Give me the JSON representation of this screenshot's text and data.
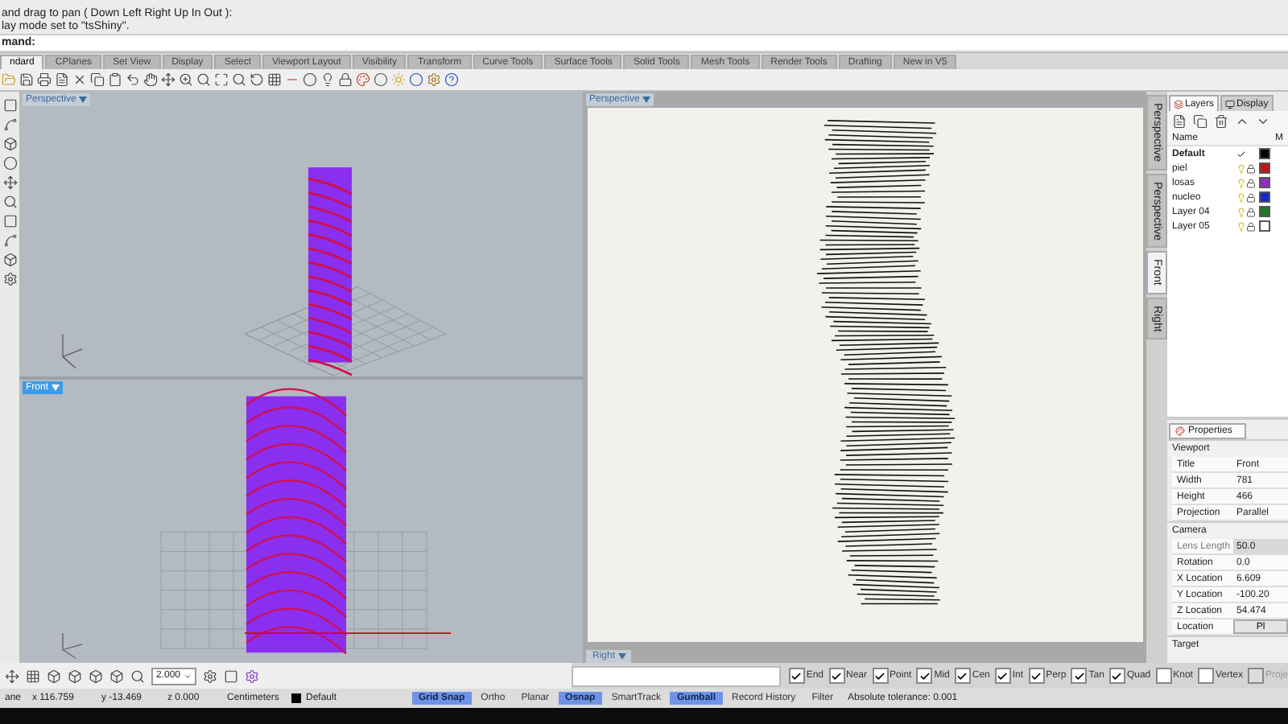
{
  "command_lines": [
    "and drag to pan ( Down  Left  Right  Up  In  Out ):",
    "lay mode set to \"tsShiny\"."
  ],
  "command_prompt": "mand:",
  "toolbar_tabs": [
    {
      "label": "ndard",
      "selected": true
    },
    {
      "label": "CPlanes",
      "selected": false
    },
    {
      "label": "Set View",
      "selected": false
    },
    {
      "label": "Display",
      "selected": false
    },
    {
      "label": "Select",
      "selected": false
    },
    {
      "label": "Viewport Layout",
      "selected": false
    },
    {
      "label": "Visibility",
      "selected": false
    },
    {
      "label": "Transform",
      "selected": false
    },
    {
      "label": "Curve Tools",
      "selected": false
    },
    {
      "label": "Surface Tools",
      "selected": false
    },
    {
      "label": "Solid Tools",
      "selected": false
    },
    {
      "label": "Mesh Tools",
      "selected": false
    },
    {
      "label": "Render Tools",
      "selected": false
    },
    {
      "label": "Drafting",
      "selected": false
    },
    {
      "label": "New in V5",
      "selected": false
    }
  ],
  "viewports": [
    {
      "title": "Perspective",
      "selected": false,
      "kind": "perspective"
    },
    {
      "title": "Front",
      "selected": true,
      "kind": "front"
    },
    {
      "title": "Perspective",
      "selected": false,
      "kind": "paper"
    }
  ],
  "hidden_viewport_title": "Right",
  "viewport_tabs": [
    {
      "label": "Perspective",
      "selected": false
    },
    {
      "label": "Perspective",
      "selected": false
    },
    {
      "label": "Front",
      "selected": true
    },
    {
      "label": "Right",
      "selected": false
    }
  ],
  "layers": {
    "tabs": [
      {
        "label": "Layers",
        "selected": true
      },
      {
        "label": "Display",
        "selected": false
      }
    ],
    "columns": [
      "Name",
      "M"
    ],
    "rows": [
      {
        "name": "Default",
        "current": true,
        "color": "#000000"
      },
      {
        "name": "piel",
        "current": false,
        "color": "#c0161c"
      },
      {
        "name": "losas",
        "current": false,
        "color": "#8e2fc0"
      },
      {
        "name": "nucleo",
        "current": false,
        "color": "#1428d0"
      },
      {
        "name": "Layer 04",
        "current": false,
        "color": "#1e7a24"
      },
      {
        "name": "Layer 05",
        "current": false,
        "color": "#ffffff"
      }
    ]
  },
  "properties": {
    "title": "Properties",
    "sections": [
      {
        "title": "Viewport",
        "rows": [
          {
            "label": "Title",
            "value": "Front",
            "disabled": false,
            "kind": "text"
          },
          {
            "label": "Width",
            "value": "781",
            "disabled": false,
            "kind": "text"
          },
          {
            "label": "Height",
            "value": "466",
            "disabled": false,
            "kind": "text"
          },
          {
            "label": "Projection",
            "value": "Parallel",
            "disabled": false,
            "kind": "text"
          }
        ]
      },
      {
        "title": "Camera",
        "rows": [
          {
            "label": "Lens Length",
            "value": "50.0",
            "disabled": true,
            "kind": "text"
          },
          {
            "label": "Rotation",
            "value": "0.0",
            "disabled": false,
            "kind": "text"
          },
          {
            "label": "X Location",
            "value": "6.609",
            "disabled": false,
            "kind": "text"
          },
          {
            "label": "Y Location",
            "value": "-100.20",
            "disabled": false,
            "kind": "text"
          },
          {
            "label": "Z Location",
            "value": "54.474",
            "disabled": false,
            "kind": "text"
          },
          {
            "label": "Location",
            "value": "Pl",
            "disabled": false,
            "kind": "button"
          }
        ]
      },
      {
        "title": "Target"
      }
    ]
  },
  "spin_field": {
    "value": "2.000"
  },
  "osnaps": [
    {
      "label": "End",
      "checked": true,
      "disabled": false
    },
    {
      "label": "Near",
      "checked": true,
      "disabled": false
    },
    {
      "label": "Point",
      "checked": true,
      "disabled": false
    },
    {
      "label": "Mid",
      "checked": true,
      "disabled": false
    },
    {
      "label": "Cen",
      "checked": true,
      "disabled": false
    },
    {
      "label": "Int",
      "checked": true,
      "disabled": false
    },
    {
      "label": "Perp",
      "checked": true,
      "disabled": false
    },
    {
      "label": "Tan",
      "checked": true,
      "disabled": false
    },
    {
      "label": "Quad",
      "checked": true,
      "disabled": false
    },
    {
      "label": "Knot",
      "checked": false,
      "disabled": false
    },
    {
      "label": "Vertex",
      "checked": false,
      "disabled": false
    },
    {
      "label": "Proje",
      "checked": false,
      "disabled": true
    }
  ],
  "status": {
    "cplane": "ane",
    "x": "x 116.759",
    "y": "y -13.469",
    "z": "z 0.000",
    "units": "Centimeters",
    "layer": {
      "name": "Default",
      "color": "#000000"
    },
    "toggles": [
      {
        "label": "Grid Snap",
        "on": true
      },
      {
        "label": "Ortho",
        "on": false
      },
      {
        "label": "Planar",
        "on": false
      },
      {
        "label": "Osnap",
        "on": true
      },
      {
        "label": "SmartTrack",
        "on": false
      },
      {
        "label": "Gumball",
        "on": true
      },
      {
        "label": "Record History",
        "on": false
      },
      {
        "label": "Filter",
        "on": false
      }
    ],
    "tolerance": "Absolute tolerance: 0.001"
  }
}
